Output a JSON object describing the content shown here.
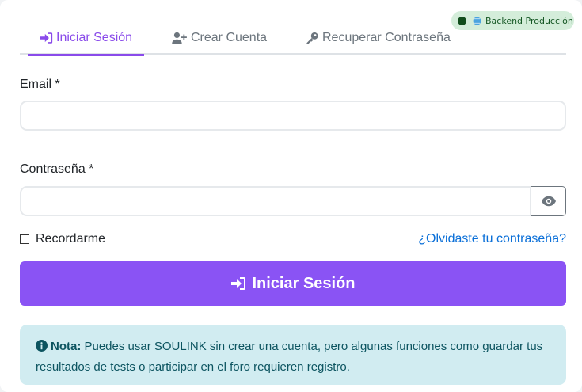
{
  "tabs": [
    {
      "label": "Iniciar Sesión",
      "icon": "sign-in-icon",
      "active": true
    },
    {
      "label": "Crear Cuenta",
      "icon": "user-plus-icon",
      "active": false
    },
    {
      "label": "Recuperar Contraseña",
      "icon": "key-icon",
      "active": false
    }
  ],
  "badge": {
    "label": "Backend Producción",
    "status_color": "#114d1c"
  },
  "form": {
    "email_label": "Email *",
    "email_value": "",
    "password_label": "Contraseña *",
    "password_value": "",
    "remember_label": "Recordarme",
    "remember_checked": false,
    "forgot_link": "¿Olvidaste tu contraseña?",
    "submit_label": "Iniciar Sesión"
  },
  "note": {
    "title": "Nota:",
    "text": " Puedes usar SOULINK sin crear una cuenta, pero algunas funciones como guardar tus resultados de tests o participar en el foro requieren registro."
  },
  "colors": {
    "accent": "#8a53f4",
    "tab_active": "#8a4bea",
    "link": "#0a6fd8",
    "note_bg": "#d1ecf1",
    "badge_bg": "#d4edda"
  }
}
